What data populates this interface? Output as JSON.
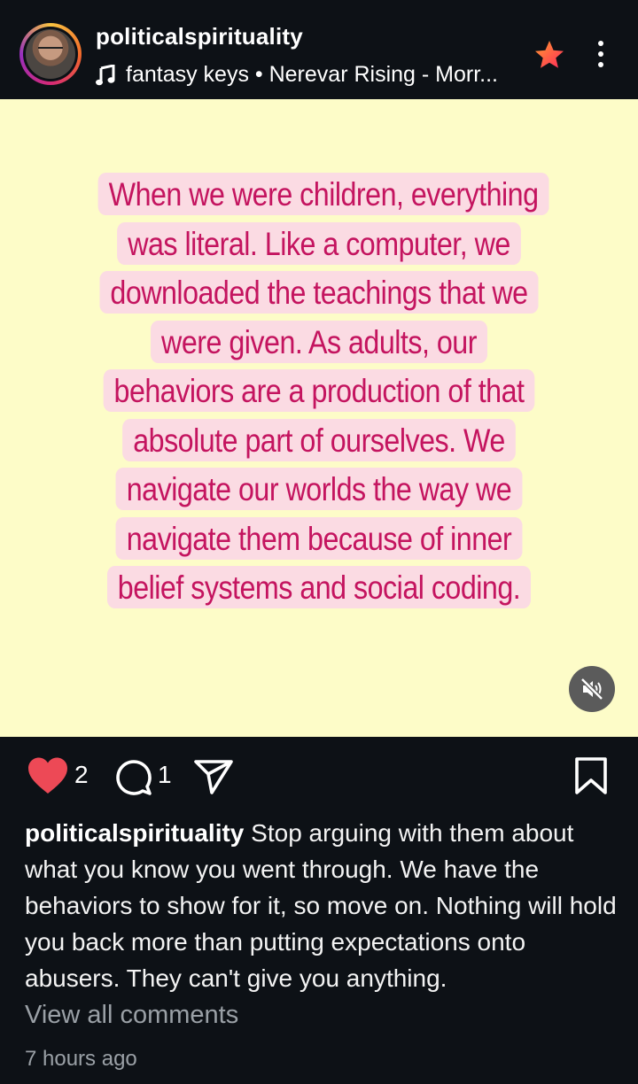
{
  "header": {
    "username": "politicalspirituality",
    "audio": "fantasy keys • Nerevar Rising - Morr...",
    "star_icon": "star-icon",
    "more_icon": "more-vertical-icon"
  },
  "post": {
    "background": "#fdfcc8",
    "text_color": "#c4145f",
    "highlight_color": "#fbdbe3",
    "quote": "When we were children, everything was literal. Like a computer, we downloaded the teachings that we were given. As adults, our behaviors are a production of that absolute part of ourselves. We navigate our worlds the way we navigate them because of inner belief systems and social coding.",
    "mute_icon": "speaker-muted-icon"
  },
  "actions": {
    "likes": "2",
    "comments": "1",
    "like_color": "#ed4956"
  },
  "caption": {
    "username": "politicalspirituality",
    "text": "Stop arguing with them about what you know you went through. We have the behaviors to show for it, so move on. Nothing will hold you back more than putting expectations onto abusers. They can't give you anything."
  },
  "view_comments": "View all comments",
  "timestamp": "7 hours ago"
}
